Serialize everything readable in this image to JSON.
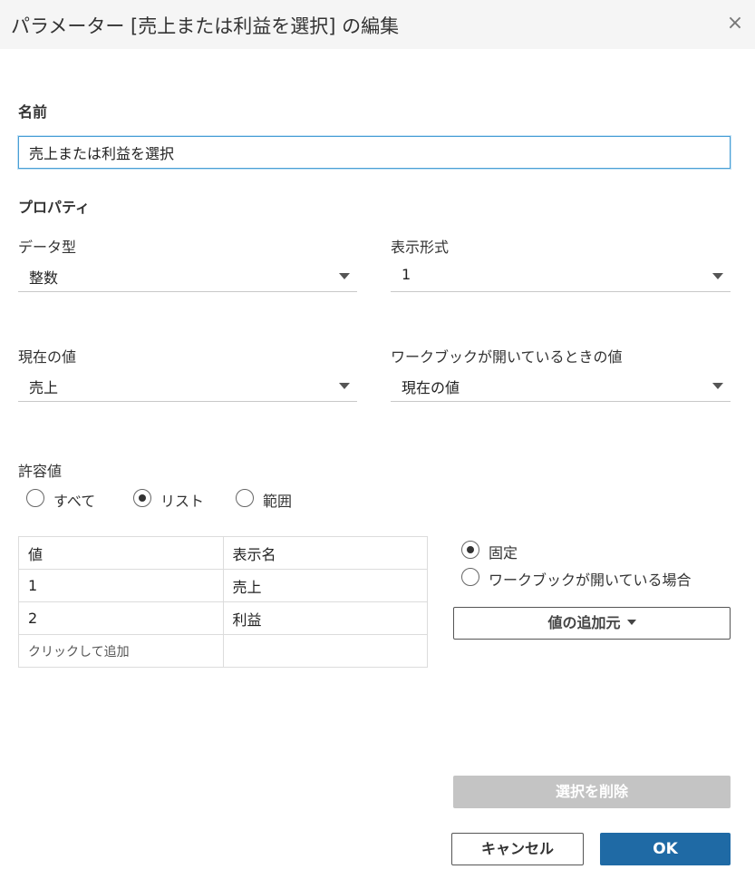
{
  "dialog": {
    "title": "パラメーター [売上または利益を選択] の編集",
    "close_glyph": "×"
  },
  "name_section": {
    "label": "名前",
    "value": "売上または利益を選択"
  },
  "properties": {
    "label": "プロパティ",
    "data_type": {
      "label": "データ型",
      "value": "整数"
    },
    "display_format": {
      "label": "表示形式",
      "value": "1"
    },
    "current_value": {
      "label": "現在の値",
      "value": "売上"
    },
    "workbook_open_value": {
      "label": "ワークブックが開いているときの値",
      "value": "現在の値"
    }
  },
  "allowable_values": {
    "label": "許容値",
    "options": [
      {
        "label": "すべて",
        "checked": false
      },
      {
        "label": "リスト",
        "checked": true
      },
      {
        "label": "範囲",
        "checked": false
      }
    ]
  },
  "list_table": {
    "headers": [
      "値",
      "表示名"
    ],
    "rows": [
      {
        "value": "1",
        "display": "売上"
      },
      {
        "value": "2",
        "display": "利益"
      }
    ],
    "add_placeholder": "クリックして追加"
  },
  "list_source": {
    "options": [
      {
        "label": "固定",
        "checked": true
      },
      {
        "label": "ワークブックが開いている場合",
        "checked": false
      }
    ],
    "add_values_label": "値の追加元"
  },
  "footer": {
    "delete_label": "選択を削除",
    "cancel_label": "キャンセル",
    "ok_label": "OK"
  },
  "colors": {
    "primary": "#1f6aa5",
    "disabled": "#c4c4c4",
    "focus_border": "#4a9fd5"
  }
}
